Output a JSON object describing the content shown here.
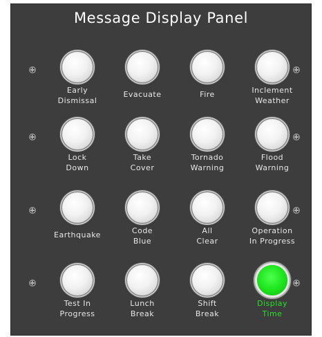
{
  "panel": {
    "title": "Message Display Panel"
  },
  "colors": {
    "panel_bg": "#3d3d3d",
    "label_text": "#e8e8e8",
    "active_green": "#1ee61e"
  },
  "buttons": [
    {
      "id": "early-dismissal",
      "lines": [
        "Early",
        "Dismissal"
      ],
      "active": false
    },
    {
      "id": "evacuate",
      "lines": [
        "Evacuate"
      ],
      "active": false
    },
    {
      "id": "fire",
      "lines": [
        "Fire"
      ],
      "active": false
    },
    {
      "id": "inclement-weather",
      "lines": [
        "Inclement",
        "Weather"
      ],
      "active": false
    },
    {
      "id": "lock-down",
      "lines": [
        "Lock",
        "Down"
      ],
      "active": false
    },
    {
      "id": "take-cover",
      "lines": [
        "Take",
        "Cover"
      ],
      "active": false
    },
    {
      "id": "tornado-warning",
      "lines": [
        "Tornado",
        "Warning"
      ],
      "active": false
    },
    {
      "id": "flood-warning",
      "lines": [
        "Flood",
        "Warning"
      ],
      "active": false
    },
    {
      "id": "earthquake",
      "lines": [
        "Earthquake"
      ],
      "active": false
    },
    {
      "id": "code-blue",
      "lines": [
        "Code",
        "Blue"
      ],
      "active": false
    },
    {
      "id": "all-clear",
      "lines": [
        "All",
        "Clear"
      ],
      "active": false
    },
    {
      "id": "operation-in-progress",
      "lines": [
        "Operation",
        "In Progress"
      ],
      "active": false
    },
    {
      "id": "test-in-progress",
      "lines": [
        "Test In",
        "Progress"
      ],
      "active": false
    },
    {
      "id": "lunch-break",
      "lines": [
        "Lunch",
        "Break"
      ],
      "active": false
    },
    {
      "id": "shift-break",
      "lines": [
        "Shift",
        "Break"
      ],
      "active": false
    },
    {
      "id": "display-time",
      "lines": [
        "Display",
        "Time"
      ],
      "active": true
    }
  ]
}
